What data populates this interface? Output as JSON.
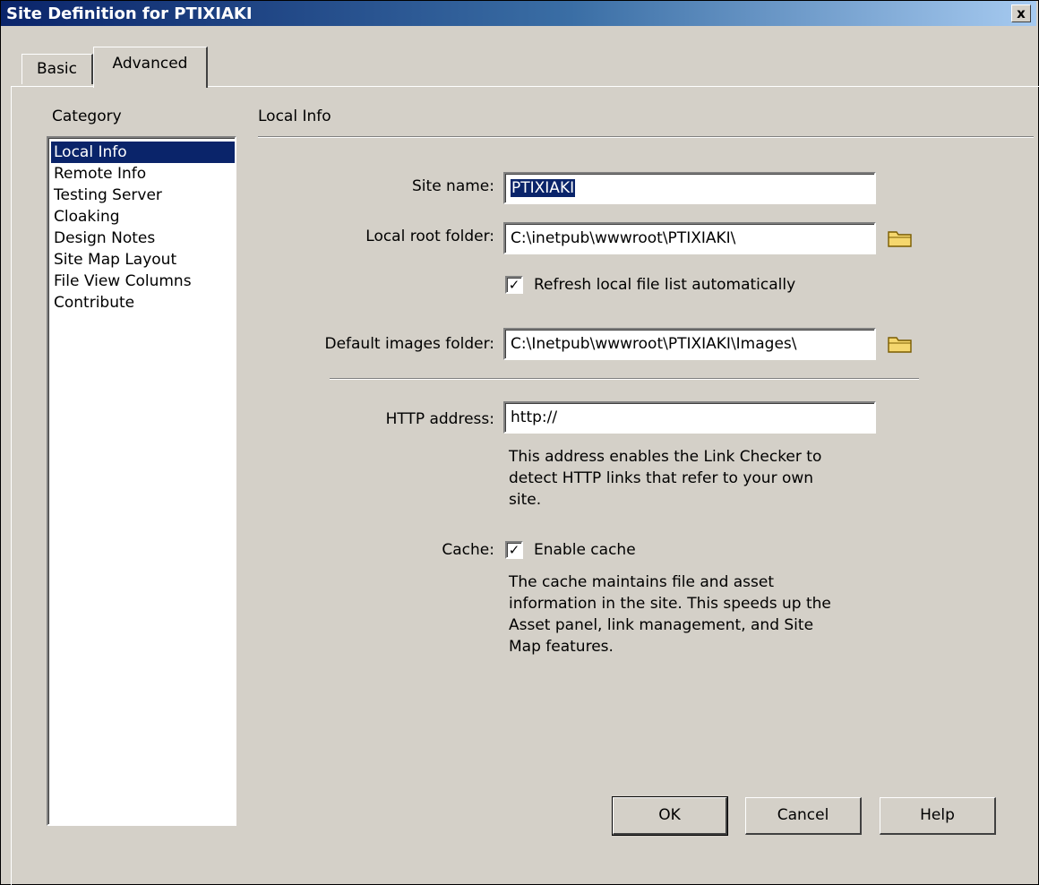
{
  "window": {
    "title": "Site Definition for PTIXIAKI",
    "close_label": "x"
  },
  "tabs": [
    {
      "label": "Basic"
    },
    {
      "label": "Advanced"
    }
  ],
  "category": {
    "heading": "Category",
    "items": [
      {
        "label": "Local Info"
      },
      {
        "label": "Remote Info"
      },
      {
        "label": "Testing Server"
      },
      {
        "label": "Cloaking"
      },
      {
        "label": "Design Notes"
      },
      {
        "label": "Site Map Layout"
      },
      {
        "label": "File View Columns"
      },
      {
        "label": "Contribute"
      }
    ],
    "selected": "Local Info"
  },
  "local_info": {
    "title": "Local Info",
    "site_name": {
      "label": "Site name:",
      "value": "PTIXIAKI"
    },
    "local_root": {
      "label": "Local root folder:",
      "value": "C:\\inetpub\\wwwroot\\PTIXIAKI\\"
    },
    "refresh": {
      "label": "Refresh local file list automatically",
      "checked": true
    },
    "images_folder": {
      "label": "Default images folder:",
      "value": "C:\\Inetpub\\wwwroot\\PTIXIAKI\\Images\\"
    },
    "http": {
      "label": "HTTP address:",
      "value": "http://",
      "desc": [
        "This address enables the Link Checker to",
        "detect HTTP links that refer to your own",
        "site."
      ]
    },
    "cache": {
      "label": "Cache:",
      "checkbox_label": "Enable cache",
      "checked": true,
      "desc": [
        "The cache maintains file and asset",
        "information in the site.  This speeds up the",
        "Asset panel, link management, and Site",
        "Map features."
      ]
    }
  },
  "buttons": {
    "ok": "OK",
    "cancel": "Cancel",
    "help": "Help"
  },
  "colors": {
    "face": "#d4d0c8",
    "selection": "#0a246a",
    "title_start": "#0a246a",
    "title_end": "#a6caf0",
    "folder": "#f5d76e"
  }
}
